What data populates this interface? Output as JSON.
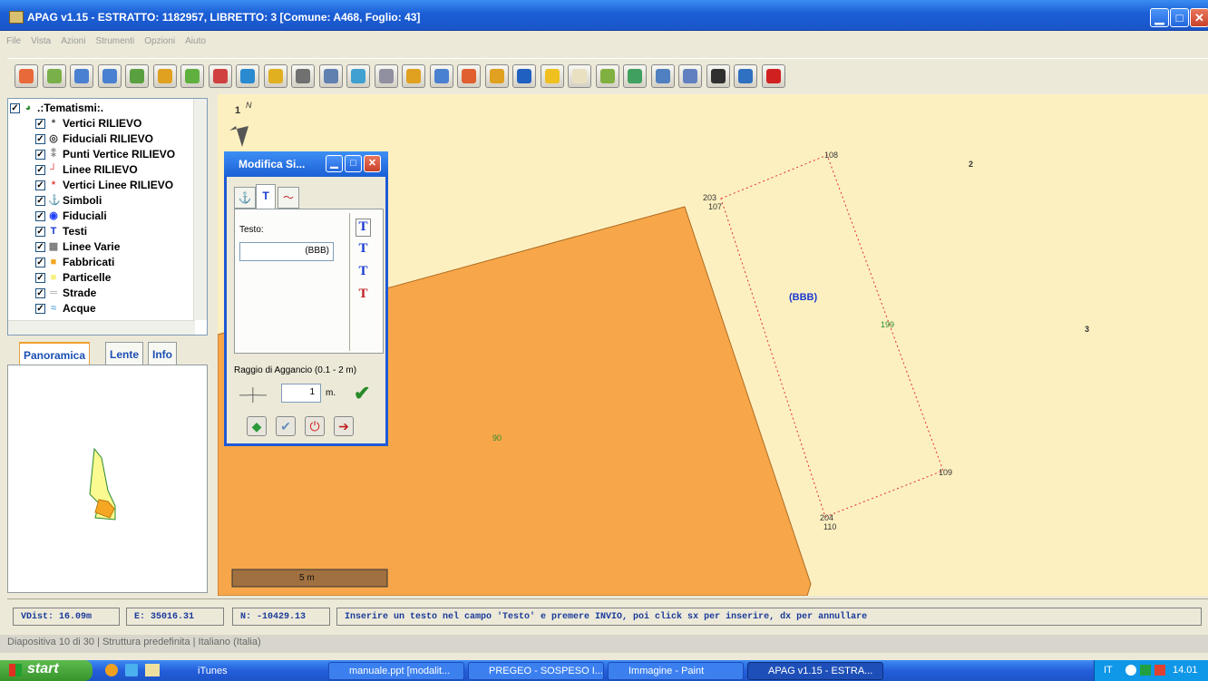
{
  "window": {
    "title": "APAG v1.15 - ESTRATTO: 1182957, LIBRETTO: 3 [Comune: A468, Foglio: 43]"
  },
  "menu": [
    "File",
    "Vista",
    "Azioni",
    "Strumenti",
    "Opzioni",
    "Aiuto"
  ],
  "toolbar_icons": [
    "zoom-icon",
    "zoom-extent-icon",
    "zoom-in-icon",
    "zoom-out-icon",
    "zoom-window-icon",
    "pan-icon",
    "snap-icon",
    "fit-icon",
    "globe-icon",
    "corner-icon",
    "gps-icon",
    "link-icon",
    "search-icon",
    "table-icon",
    "grid-icon",
    "measure-icon",
    "import-icon",
    "export-icon",
    "save-icon",
    "layers-icon",
    "sequence-icon",
    "edit-icon",
    "check-icon",
    "select-icon",
    "copy-icon",
    "print-icon",
    "help-icon",
    "power-icon"
  ],
  "tree": {
    "root": ".:Tematismi:.",
    "items": [
      {
        "label": "Vertici RILIEVO",
        "icon": "*",
        "color": "#444"
      },
      {
        "label": "Fiduciali RILIEVO",
        "icon": "◎",
        "color": "#333"
      },
      {
        "label": "Punti Vertice RILIEVO",
        "icon": "⁑",
        "color": "#888"
      },
      {
        "label": "Linee RILIEVO",
        "icon": "┘",
        "color": "#e04040"
      },
      {
        "label": "Vertici Linee RILIEVO",
        "icon": "*",
        "color": "#e04040"
      },
      {
        "label": "Simboli",
        "icon": "⚓",
        "color": "#2040c0"
      },
      {
        "label": "Fiduciali",
        "icon": "◉",
        "color": "#2040ff"
      },
      {
        "label": "Testi",
        "icon": "T",
        "color": "#1a3ad0"
      },
      {
        "label": "Linee Varie",
        "icon": "▦",
        "color": "#777"
      },
      {
        "label": "Fabbricati",
        "icon": "■",
        "color": "#f5a623"
      },
      {
        "label": "Particelle",
        "icon": "■",
        "color": "#f8f080"
      },
      {
        "label": "Strade",
        "icon": "═",
        "color": "#aaa"
      },
      {
        "label": "Acque",
        "icon": "≈",
        "color": "#6ab0e0"
      }
    ]
  },
  "panel_tabs": [
    "Panoramica",
    "Lente",
    "Info"
  ],
  "dialog": {
    "title": "Modifica Si...",
    "tabs": [
      "⚓",
      "T",
      "〜"
    ],
    "testo_label": "Testo:",
    "testo_value": "(BBB)",
    "raggio_label": "Raggio di Aggancio (0.1 - 2 m)",
    "raggio_value": "1",
    "raggio_unit": "m."
  },
  "map": {
    "north": "N",
    "north_num": "1",
    "labels": {
      "l108": "108",
      "l2": "2",
      "l203": "203",
      "l107": "107",
      "lbbb": "(BBB)",
      "l199": "199",
      "l3": "3",
      "l90": "90",
      "l109": "109",
      "l204": "204",
      "l110": "110"
    },
    "scale": "5 m"
  },
  "status": {
    "vdist": "VDist: 16.09m",
    "e": "E: 35016.31",
    "n": "N: -10429.13",
    "msg": "Inserire un testo nel campo 'Testo' e premere INVIO, poi click sx per inserire, dx per annullare"
  },
  "behind": "Diapositiva 10 di 30   |   Struttura predefinita   |   Italiano (Italia)",
  "taskbar": {
    "start": "start",
    "tasks": [
      "iTunes",
      "manuale.ppt [modalit...",
      "PREGEO - SOSPESO I...",
      "Immagine - Paint",
      "APAG v1.15 - ESTRA..."
    ],
    "lang": "IT",
    "clock": "14.01"
  }
}
